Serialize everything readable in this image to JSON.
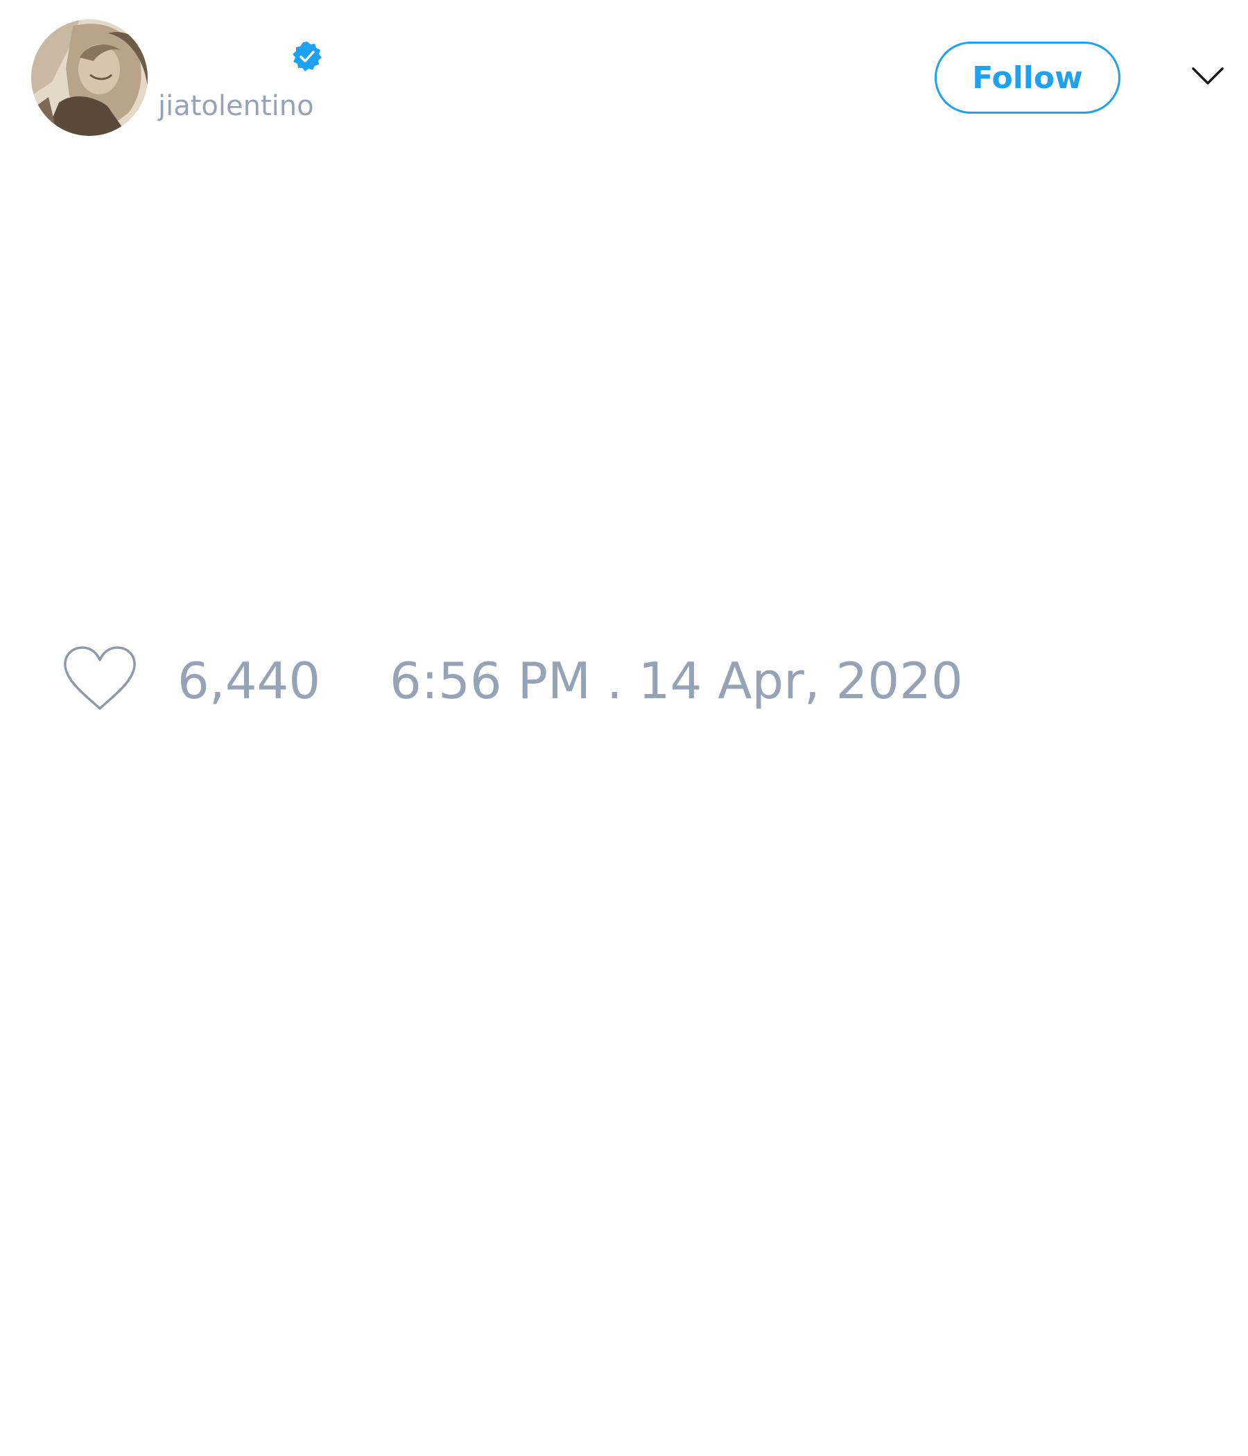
{
  "user": {
    "handle": "jiatolentino",
    "verified": true,
    "avatar_description": "sepia portrait photo"
  },
  "header": {
    "follow_label": "Follow",
    "menu_icon": "chevron-down-icon",
    "verified_icon": "verified-badge-icon"
  },
  "footer": {
    "like_icon": "heart-icon",
    "like_count": "6,440",
    "timestamp": "6:56 PM . 14 Apr, 2020"
  },
  "colors": {
    "accent": "#1da1f2",
    "muted_text": "#95a3b6",
    "icon_stroke": "#8e9aa8",
    "chevron": "#1a1a1a",
    "background": "#ffffff"
  }
}
